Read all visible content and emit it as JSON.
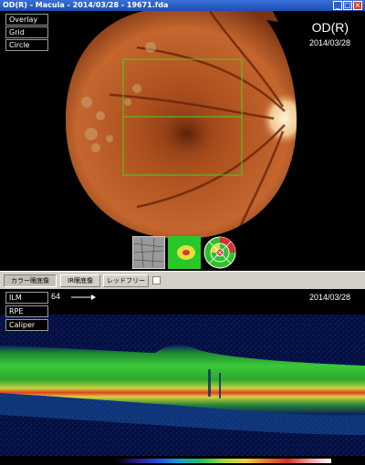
{
  "window": {
    "title": "OD(R) - Macula - 2014/03/28 - 19671.fda",
    "controls": [
      "_",
      "□",
      "×"
    ]
  },
  "fundus": {
    "overlay_buttons": [
      "Overlay",
      "Grid",
      "Circle"
    ],
    "eye": "OD(R)",
    "date": "2014/03/28"
  },
  "toolbar": {
    "tabs": [
      "カラー眼底像",
      "IR眼底像",
      "レッドフリー"
    ],
    "selected_tab": "カラー眼底像",
    "redfree_checkbox_checked": false
  },
  "oct": {
    "layer_buttons": [
      "ILM",
      "RPE",
      "Caliper"
    ],
    "slice_value": "64",
    "date": "2014/03/28"
  },
  "icons": {
    "thumb_1": "oct-projection-thumbnail-icon",
    "thumb_2": "thickness-map-thumbnail-icon",
    "thumb_3": "etdrs-grid-thumbnail-icon",
    "arrow": "arrow-right-icon"
  }
}
